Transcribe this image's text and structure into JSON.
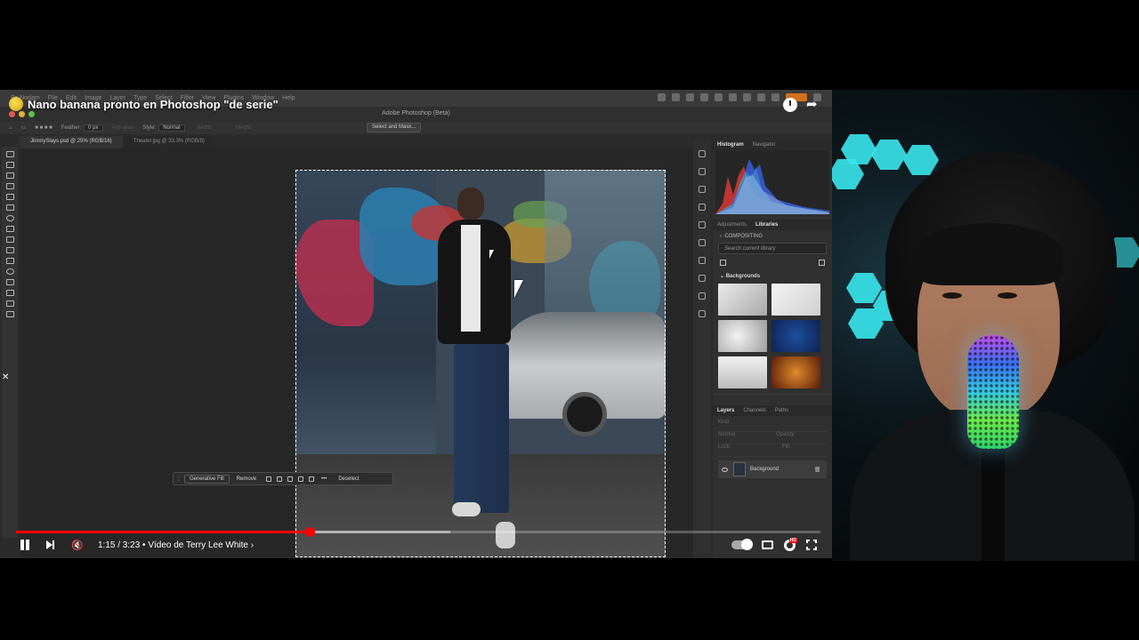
{
  "video": {
    "title": "Nano banana pronto en Photoshop \"de serie\"",
    "time": "1:15 / 3:23 • Vídeo de Terry Lee White ›",
    "progress_played": 0.365,
    "progress_buffered": 0.54
  },
  "photoshop": {
    "app_title": "Adobe Photoshop (Beta)",
    "menu": [
      "Ps Nodam",
      "File",
      "Edit",
      "Image",
      "Layer",
      "Type",
      "Select",
      "Filter",
      "View",
      "Plugins",
      "Window",
      "Help"
    ],
    "options": {
      "feather_label": "Feather:",
      "feather_value": "0 px",
      "anti_alias": "Anti-alias",
      "style_label": "Style:",
      "style_value": "Normal",
      "width_label": "Width:",
      "height_label": "Height:",
      "select_mask": "Select and Mask..."
    },
    "tabs": [
      "JimmySlays.psd @ 25% (RGB/16)",
      "Theater.jpg @ 33.3% (RGB/8)"
    ],
    "taskbar": {
      "generative_fill": "Generative Fill",
      "remove": "Remove",
      "more": "•••",
      "deselect": "Deselect"
    },
    "panels": {
      "top_tabs": [
        "Histogram",
        "Navigator"
      ],
      "mid_tabs": [
        "Adjustments",
        "Libraries"
      ],
      "library_name": "COMPOSITING",
      "search_placeholder": "Search current library",
      "backgrounds_label": "Backgrounds",
      "layers_tabs": [
        "Layers",
        "Channels",
        "Paths"
      ],
      "layers_kind": "Kind",
      "layers_mode": "Normal",
      "layers_opacity": "Opacity:",
      "layers_lock": "Lock:",
      "layers_fill": "Fill:",
      "layer_name": "Background"
    }
  },
  "colors": {
    "progress_red": "#ff0000",
    "hex_light": "#39e6ee"
  }
}
